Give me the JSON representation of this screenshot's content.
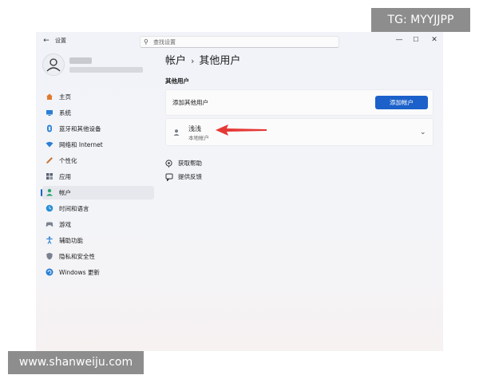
{
  "window": {
    "title": "设置",
    "back_glyph": "←",
    "minimize_glyph": "—",
    "maximize_glyph": "☐",
    "close_glyph": "✕"
  },
  "search": {
    "placeholder": "查找设置",
    "icon": "search-icon"
  },
  "profile": {
    "avatar_icon": "person-icon"
  },
  "sidebar": {
    "items": [
      {
        "label": "主页",
        "icon": "home-icon",
        "color": "#e07a2e",
        "selected": false
      },
      {
        "label": "系统",
        "icon": "system-icon",
        "color": "#2a7fd4",
        "selected": false
      },
      {
        "label": "蓝牙和其他设备",
        "icon": "bluetooth-icon",
        "color": "#2a7fd4",
        "selected": false
      },
      {
        "label": "网络和 Internet",
        "icon": "network-icon",
        "color": "#2a7fd4",
        "selected": false
      },
      {
        "label": "个性化",
        "icon": "personalization-icon",
        "color": "#c8763a",
        "selected": false
      },
      {
        "label": "应用",
        "icon": "apps-icon",
        "color": "#5a6272",
        "selected": false
      },
      {
        "label": "帐户",
        "icon": "accounts-icon",
        "color": "#2aa56d",
        "selected": true
      },
      {
        "label": "时间和语言",
        "icon": "time-language-icon",
        "color": "#2a8fd4",
        "selected": false
      },
      {
        "label": "游戏",
        "icon": "gaming-icon",
        "color": "#7a8290",
        "selected": false
      },
      {
        "label": "辅助功能",
        "icon": "accessibility-icon",
        "color": "#2a7fd4",
        "selected": false
      },
      {
        "label": "隐私和安全性",
        "icon": "shield-icon",
        "color": "#7a8290",
        "selected": false
      },
      {
        "label": "Windows 更新",
        "icon": "windows-update-icon",
        "color": "#2a7fd4",
        "selected": false
      }
    ]
  },
  "main": {
    "breadcrumb": {
      "parent": "帐户",
      "separator": "›",
      "current": "其他用户"
    },
    "section_title": "其他用户",
    "add_card": {
      "label": "添加其他用户",
      "button_label": "添加帐户"
    },
    "user_card": {
      "name": "浅浅",
      "type": "本地帐户",
      "icon": "user-icon",
      "expand_glyph": "⌄"
    },
    "links": [
      {
        "label": "获取帮助",
        "icon": "help-icon"
      },
      {
        "label": "提供反馈",
        "icon": "feedback-icon"
      }
    ]
  },
  "overlays": {
    "tg": "TG: MYYJJPP",
    "site": "www.shanweiju.com"
  },
  "colors": {
    "accent": "#1b61c9",
    "annotation_arrow": "#e53935"
  }
}
